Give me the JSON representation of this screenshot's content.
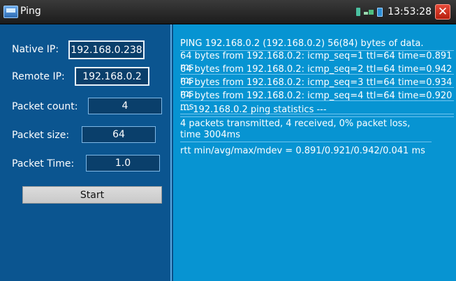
{
  "window": {
    "title": "Ping",
    "app_icon": "ping-app-icon"
  },
  "status_bar": {
    "clock": "13:53:28",
    "icons": [
      "sim-icon",
      "network-icon",
      "battery-icon"
    ],
    "close": "close-icon"
  },
  "form": {
    "native_ip": {
      "label": "Native IP:",
      "value": "192.168.0.238"
    },
    "remote_ip": {
      "label": "Remote IP:",
      "value": "192.168.0.2"
    },
    "packet_count": {
      "label": "Packet count:",
      "value": "4"
    },
    "packet_size": {
      "label": "Packet size:",
      "value": "64"
    },
    "packet_time": {
      "label": "Packet Time:",
      "value": "1.0"
    },
    "start_label": "Start"
  },
  "output": {
    "lines": [
      "PING 192.168.0.2 (192.168.0.2) 56(84) bytes of data.",
      "64 bytes from 192.168.0.2: icmp_seq=1 ttl=64 time=0.891 ms",
      "64 bytes from 192.168.0.2: icmp_seq=2 ttl=64 time=0.942 ms",
      "64 bytes from 192.168.0.2: icmp_seq=3 ttl=64 time=0.934 ms",
      "64 bytes from 192.168.0.2: icmp_seq=4 ttl=64 time=0.920 ms",
      "--- 192.168.0.2 ping statistics ---",
      "4 packets transmitted, 4 received, 0% packet loss, time 3004ms",
      "rtt min/avg/max/mdev = 0.891/0.921/0.942/0.041 ms"
    ]
  },
  "colors": {
    "left_panel": "#0b5590",
    "right_panel": "#0794d2",
    "title_bar": "#2a2a2a",
    "close": "#d0331f"
  }
}
